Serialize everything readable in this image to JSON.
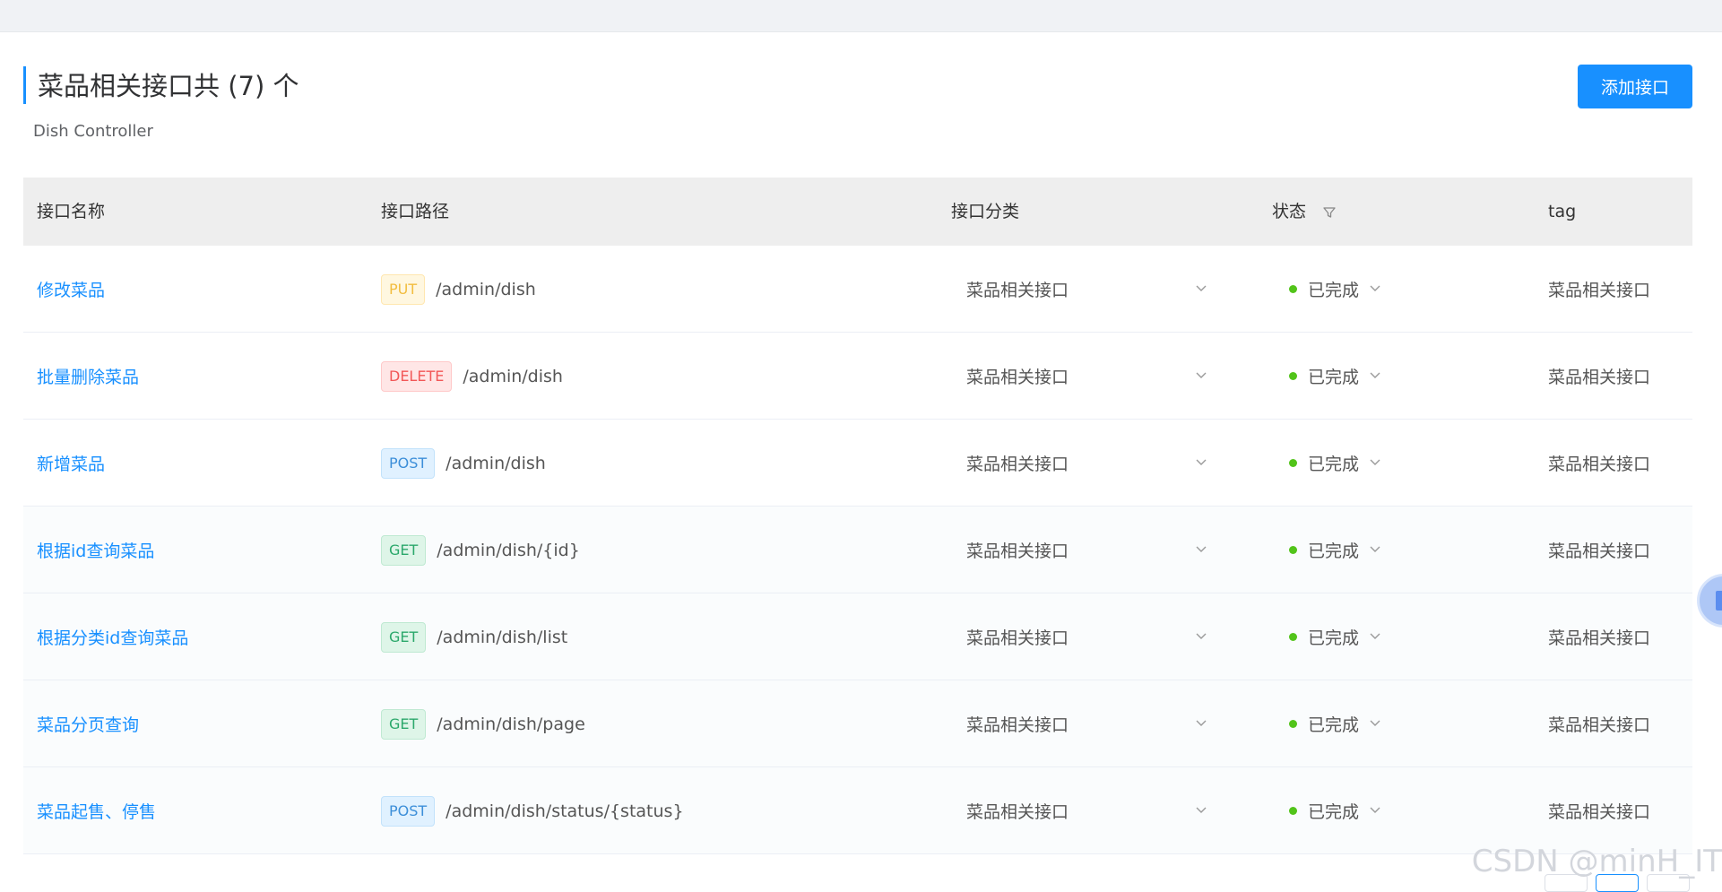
{
  "header": {
    "title": "菜品相关接口共 (7) 个",
    "subtitle": "Dish Controller",
    "add_button_label": "添加接口"
  },
  "table": {
    "columns": [
      "接口名称",
      "接口路径",
      "接口分类",
      "状态",
      "tag"
    ],
    "rows": [
      {
        "name": "修改菜品",
        "method": "PUT",
        "path": "/admin/dish",
        "category": "菜品相关接口",
        "status": "已完成",
        "tag": "菜品相关接口"
      },
      {
        "name": "批量删除菜品",
        "method": "DELETE",
        "path": "/admin/dish",
        "category": "菜品相关接口",
        "status": "已完成",
        "tag": "菜品相关接口"
      },
      {
        "name": "新增菜品",
        "method": "POST",
        "path": "/admin/dish",
        "category": "菜品相关接口",
        "status": "已完成",
        "tag": "菜品相关接口"
      },
      {
        "name": "根据id查询菜品",
        "method": "GET",
        "path": "/admin/dish/{id}",
        "category": "菜品相关接口",
        "status": "已完成",
        "tag": "菜品相关接口"
      },
      {
        "name": "根据分类id查询菜品",
        "method": "GET",
        "path": "/admin/dish/list",
        "category": "菜品相关接口",
        "status": "已完成",
        "tag": "菜品相关接口"
      },
      {
        "name": "菜品分页查询",
        "method": "GET",
        "path": "/admin/dish/page",
        "category": "菜品相关接口",
        "status": "已完成",
        "tag": "菜品相关接口"
      },
      {
        "name": "菜品起售、停售",
        "method": "POST",
        "path": "/admin/dish/status/{status}",
        "category": "菜品相关接口",
        "status": "已完成",
        "tag": "菜品相关接口"
      }
    ]
  },
  "watermark": "CSDN @minH_IT",
  "colors": {
    "accent": "#1890ff",
    "status_done": "#52c41a"
  }
}
